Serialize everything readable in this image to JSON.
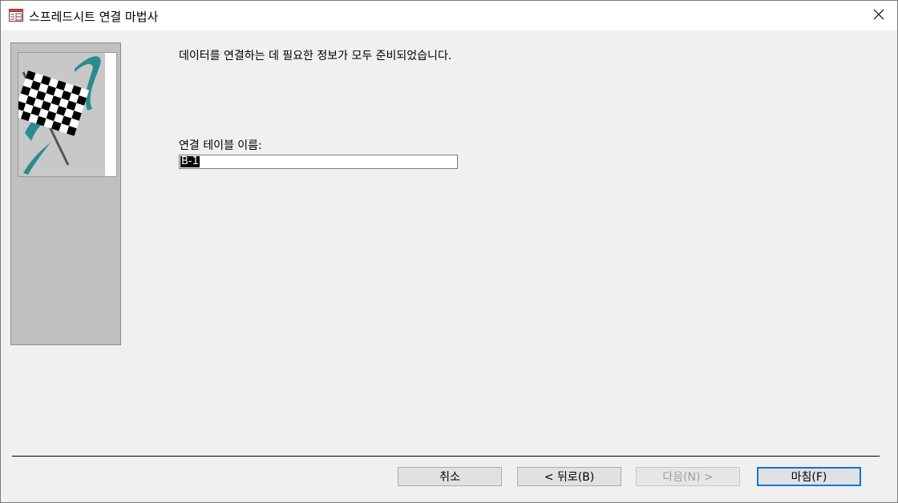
{
  "window": {
    "title": "스프레드시트 연결 마법사",
    "icons": {
      "app": "table-icon",
      "close": "close-icon"
    }
  },
  "content": {
    "message": "데이터를 연결하는 데 필요한 정보가 모두 준비되었습니다.",
    "table_name_label": "연결 테이블 이름:",
    "table_name_value": "B-1"
  },
  "sidebar": {
    "image": "checkered-flag-illustration"
  },
  "buttons": {
    "cancel": "취소",
    "back": "< 뒤로(B)",
    "next": "다음(N) >",
    "finish": "마침(F)"
  },
  "colors": {
    "accent": "#0078d7",
    "teal": "#2a8c8c",
    "panel": "#c0c0c0"
  }
}
